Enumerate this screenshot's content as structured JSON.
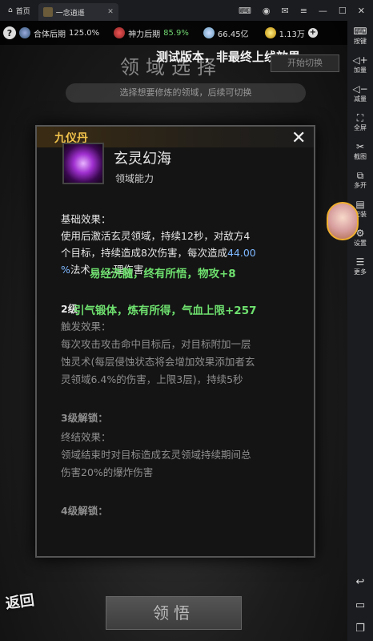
{
  "emulator": {
    "home_tab": "首页",
    "game_tab": "一念逍遥"
  },
  "resources": {
    "realm": "合体后期",
    "realm_pct": "125.0%",
    "spirit": "神力后期",
    "spirit_pct": "85.9%",
    "crystals": "66.45亿",
    "coins": "1.13万"
  },
  "screen": {
    "bg_title": "领域选择",
    "test_banner": "测试版本，非最终上线效果",
    "switch_button": "开始切换",
    "hint": "选择想要修炼的领域，后续可切换",
    "realize_button": "领悟",
    "back_button": "返回"
  },
  "popup": {
    "header_title": "九仪丹",
    "close_symbol": "✕",
    "skill_name": "玄灵幻海",
    "skill_type": "领域能力",
    "base_heading": "基础效果：",
    "base_text_1": "使用后激活玄灵领域，持续12秒，对敌方4",
    "base_text_2": "个目标，持续造成8次伤害，每次造成",
    "base_pct": "44.00",
    "base_text_3_pct": "%",
    "base_text_3": "法术…                …理伤害",
    "overlay_1": "易经洗髓，终有所悟，物攻+8",
    "overlay_2": "引气锻体，炼有所得，气血上限+257",
    "level2_partial": "2级",
    "trigger_heading": "触发效果：",
    "trigger_text_1": "每次攻击攻击命中目标后，对目标附加一层",
    "trigger_text_2": "蚀灵术(每层侵蚀状态将会增加效果添加者玄",
    "trigger_text_3": "灵领域6.4%的伤害，上限3层)，持续5秒",
    "level3_heading": "3级解锁：",
    "final_heading": "终结效果：",
    "final_text_1": "领域结束时对目标造成玄灵领域持续期间总",
    "final_text_2": "伤害20%的爆炸伤害",
    "level4_heading": "4级解锁："
  },
  "sidebar": {
    "items": [
      "按键",
      "加量",
      "减量",
      "全屏",
      "截图",
      "多开",
      "安装",
      "设置",
      "更多"
    ]
  }
}
